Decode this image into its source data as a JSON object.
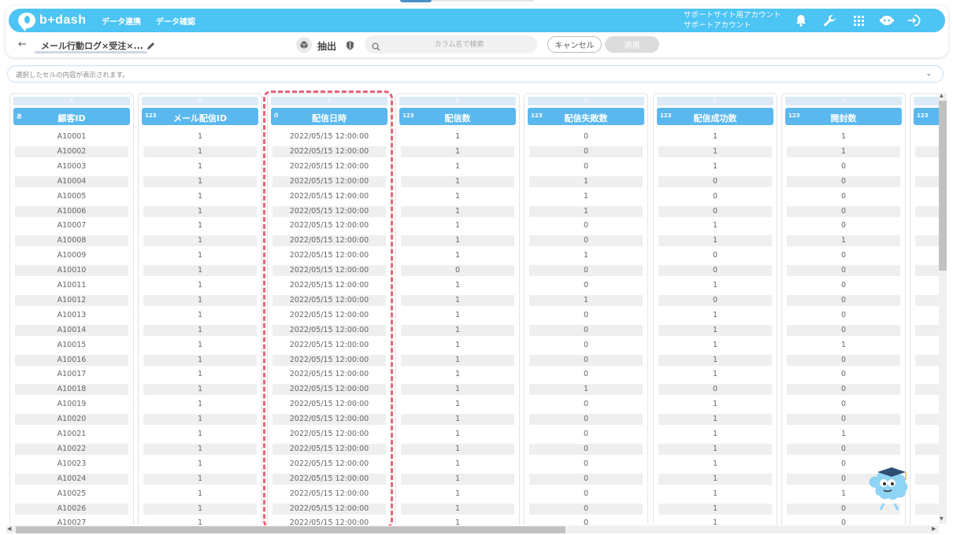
{
  "nav": {
    "brand": "b+dash",
    "links": [
      "データ連携",
      "データ確認"
    ],
    "support_line1": "サポートサイト用アカウント",
    "support_line2": "サポートアカウント",
    "icons": [
      "bell-icon",
      "wrench-icon",
      "apps-grid-icon",
      "chat-bot-icon",
      "logout-icon"
    ]
  },
  "toolbar": {
    "title": "メール行動ログ×受注×...",
    "extract_label": "抽出",
    "search_placeholder": "カラム名で検索",
    "cancel_label": "キャンセル",
    "apply_label": "適用"
  },
  "cell_bar": {
    "placeholder": "選択したセルの内容が表示されます。"
  },
  "colors": {
    "nav": "#4cc4f4",
    "header": "#5ab8ee",
    "highlight": "#e8657a"
  },
  "grid": {
    "columns": [
      {
        "letter": "A",
        "type": "あ",
        "name": "顧客ID",
        "values": [
          "A10001",
          "A10002",
          "A10003",
          "A10004",
          "A10005",
          "A10006",
          "A10007",
          "A10008",
          "A10009",
          "A10010",
          "A10011",
          "A10012",
          "A10013",
          "A10014",
          "A10015",
          "A10016",
          "A10017",
          "A10018",
          "A10019",
          "A10020",
          "A10021",
          "A10022",
          "A10023",
          "A10024",
          "A10025",
          "A10026",
          "A10027"
        ]
      },
      {
        "letter": "B",
        "type": "123",
        "name": "メール配信ID",
        "values": [
          "1",
          "1",
          "1",
          "1",
          "1",
          "1",
          "1",
          "1",
          "1",
          "1",
          "1",
          "1",
          "1",
          "1",
          "1",
          "1",
          "1",
          "1",
          "1",
          "1",
          "1",
          "1",
          "1",
          "1",
          "1",
          "1",
          "1"
        ]
      },
      {
        "letter": "C",
        "type": "⏱",
        "name": "配信日時",
        "values": [
          "2022/05/15 12:00:00",
          "2022/05/15 12:00:00",
          "2022/05/15 12:00:00",
          "2022/05/15 12:00:00",
          "2022/05/15 12:00:00",
          "2022/05/15 12:00:00",
          "2022/05/15 12:00:00",
          "2022/05/15 12:00:00",
          "2022/05/15 12:00:00",
          "2022/05/15 12:00:00",
          "2022/05/15 12:00:00",
          "2022/05/15 12:00:00",
          "2022/05/15 12:00:00",
          "2022/05/15 12:00:00",
          "2022/05/15 12:00:00",
          "2022/05/15 12:00:00",
          "2022/05/15 12:00:00",
          "2022/05/15 12:00:00",
          "2022/05/15 12:00:00",
          "2022/05/15 12:00:00",
          "2022/05/15 12:00:00",
          "2022/05/15 12:00:00",
          "2022/05/15 12:00:00",
          "2022/05/15 12:00:00",
          "2022/05/15 12:00:00",
          "2022/05/15 12:00:00",
          "2022/05/15 12:00:00"
        ]
      },
      {
        "letter": "D",
        "type": "123",
        "name": "配信数",
        "values": [
          "1",
          "1",
          "1",
          "1",
          "1",
          "1",
          "1",
          "1",
          "1",
          "0",
          "1",
          "1",
          "1",
          "1",
          "1",
          "1",
          "1",
          "1",
          "1",
          "1",
          "1",
          "1",
          "1",
          "1",
          "1",
          "1",
          "1"
        ]
      },
      {
        "letter": "E",
        "type": "123",
        "name": "配信失敗数",
        "values": [
          "0",
          "0",
          "0",
          "1",
          "1",
          "1",
          "0",
          "0",
          "1",
          "0",
          "0",
          "1",
          "0",
          "0",
          "0",
          "0",
          "0",
          "1",
          "0",
          "0",
          "0",
          "0",
          "0",
          "0",
          "0",
          "0",
          "0"
        ]
      },
      {
        "letter": "F",
        "type": "123",
        "name": "配信成功数",
        "values": [
          "1",
          "1",
          "1",
          "0",
          "0",
          "0",
          "1",
          "1",
          "0",
          "0",
          "1",
          "0",
          "1",
          "1",
          "1",
          "1",
          "1",
          "0",
          "1",
          "1",
          "1",
          "1",
          "1",
          "1",
          "1",
          "1",
          "1"
        ]
      },
      {
        "letter": "G",
        "type": "123",
        "name": "開封数",
        "values": [
          "1",
          "1",
          "0",
          "0",
          "0",
          "0",
          "0",
          "1",
          "0",
          "0",
          "0",
          "0",
          "0",
          "0",
          "1",
          "0",
          "0",
          "0",
          "0",
          "0",
          "1",
          "0",
          "0",
          "0",
          "1",
          "0",
          "0"
        ]
      }
    ],
    "partial_column": {
      "type": "123"
    }
  }
}
